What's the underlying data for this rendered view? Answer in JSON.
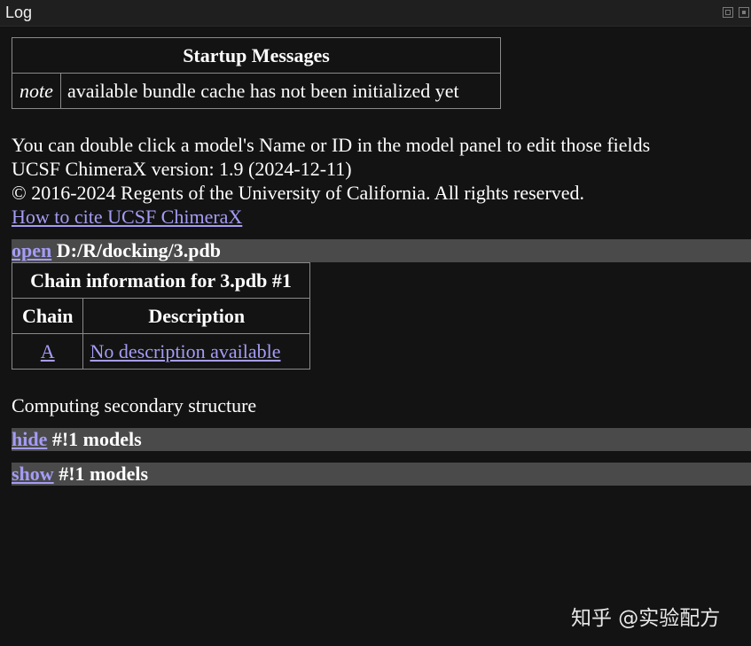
{
  "window": {
    "title": "Log",
    "float_icon": "float-icon",
    "close_icon": "close-icon"
  },
  "startup": {
    "header": "Startup Messages",
    "rows": [
      {
        "level": "note",
        "message": "available bundle cache has not been initialized yet"
      }
    ]
  },
  "info": {
    "line1": "You can double click a model's Name or ID in the model panel to edit those fields",
    "line2": "UCSF ChimeraX version: 1.9 (2024-12-11)",
    "line3": "© 2016-2024 Regents of the University of California. All rights reserved.",
    "cite_link": "How to cite UCSF ChimeraX"
  },
  "commands": [
    {
      "cmd": "open",
      "args": " D:/R/docking/3.pdb"
    },
    {
      "cmd": "hide",
      "args": " #!1 models"
    },
    {
      "cmd": "show",
      "args": " #!1 models"
    }
  ],
  "chain_table": {
    "title": "Chain information for 3.pdb #1",
    "col_chain": "Chain",
    "col_description": "Description",
    "rows": [
      {
        "chain": "A",
        "description": "No description available"
      }
    ]
  },
  "computing": "Computing secondary structure",
  "watermark": "知乎 @实验配方"
}
